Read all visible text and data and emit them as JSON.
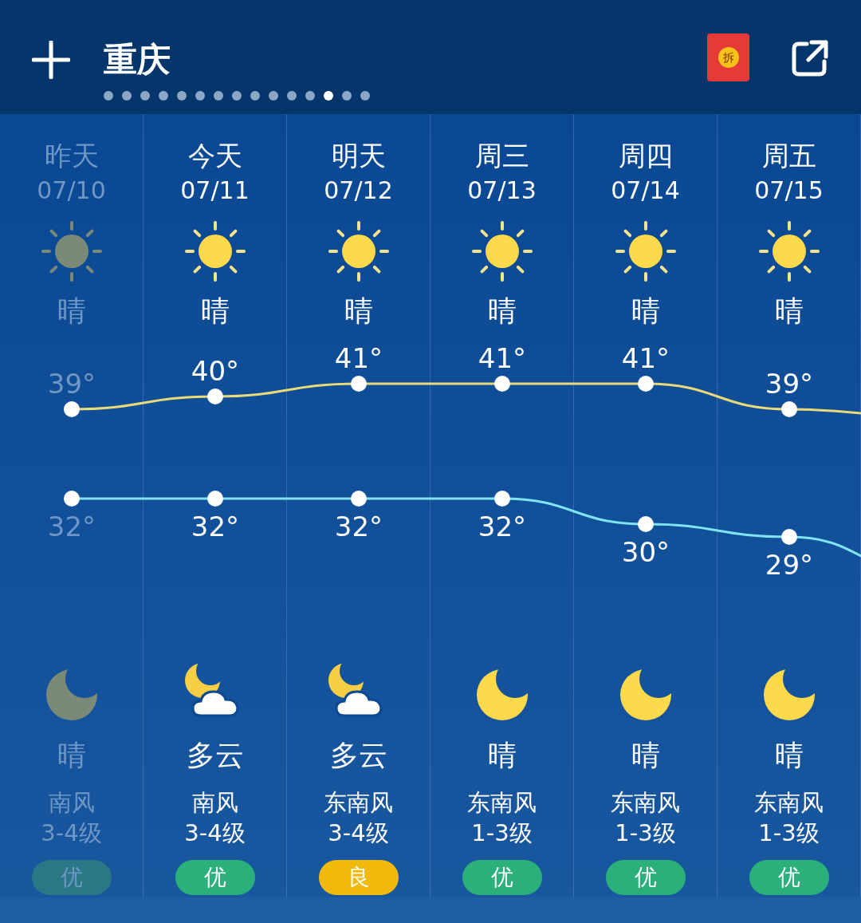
{
  "header": {
    "city": "重庆",
    "page_dots": [
      {
        "selected": false
      },
      {
        "selected": false
      },
      {
        "selected": false
      },
      {
        "selected": false
      },
      {
        "selected": false
      },
      {
        "selected": false
      },
      {
        "selected": false
      },
      {
        "selected": false
      },
      {
        "selected": false
      },
      {
        "selected": false
      },
      {
        "selected": false
      },
      {
        "selected": false
      },
      {
        "selected": true
      },
      {
        "selected": false
      },
      {
        "selected": false
      }
    ],
    "red_packet_label": "拆"
  },
  "days": [
    {
      "label": "昨天",
      "date": "07/10",
      "past": true,
      "day_icon": {
        "kind": "sunny"
      },
      "day_weather": "晴",
      "high": "39°",
      "low": "32°",
      "night_icon": {
        "kind": "moon"
      },
      "night_weather": "晴",
      "wind": "南风",
      "wind_level": "3-4级",
      "aqi": {
        "label": "优",
        "color": "#2a7786"
      }
    },
    {
      "label": "今天",
      "date": "07/11",
      "past": false,
      "day_icon": {
        "kind": "sunny"
      },
      "day_weather": "晴",
      "high": "40°",
      "low": "32°",
      "night_icon": {
        "kind": "moon_cloud"
      },
      "night_weather": "多云",
      "wind": "南风",
      "wind_level": "3-4级",
      "aqi": {
        "label": "优",
        "color": "#2bb07c"
      }
    },
    {
      "label": "明天",
      "date": "07/12",
      "past": false,
      "day_icon": {
        "kind": "sunny"
      },
      "day_weather": "晴",
      "high": "41°",
      "low": "32°",
      "night_icon": {
        "kind": "moon_cloud"
      },
      "night_weather": "多云",
      "wind": "东南风",
      "wind_level": "3-4级",
      "aqi": {
        "label": "良",
        "color": "#f0b90b"
      }
    },
    {
      "label": "周三",
      "date": "07/13",
      "past": false,
      "day_icon": {
        "kind": "sunny"
      },
      "day_weather": "晴",
      "high": "41°",
      "low": "32°",
      "night_icon": {
        "kind": "moon"
      },
      "night_weather": "晴",
      "wind": "东南风",
      "wind_level": "1-3级",
      "aqi": {
        "label": "优",
        "color": "#2bb07c"
      }
    },
    {
      "label": "周四",
      "date": "07/14",
      "past": false,
      "day_icon": {
        "kind": "sunny"
      },
      "day_weather": "晴",
      "high": "41°",
      "low": "30°",
      "night_icon": {
        "kind": "moon"
      },
      "night_weather": "晴",
      "wind": "东南风",
      "wind_level": "1-3级",
      "aqi": {
        "label": "优",
        "color": "#2bb07c"
      }
    },
    {
      "label": "周五",
      "date": "07/15",
      "past": false,
      "day_icon": {
        "kind": "sunny"
      },
      "day_weather": "晴",
      "high": "39°",
      "low": "29°",
      "night_icon": {
        "kind": "moon"
      },
      "night_weather": "晴",
      "wind": "东南风",
      "wind_level": "1-3级",
      "aqi": {
        "label": "优",
        "color": "#2bb07c"
      }
    }
  ]
}
